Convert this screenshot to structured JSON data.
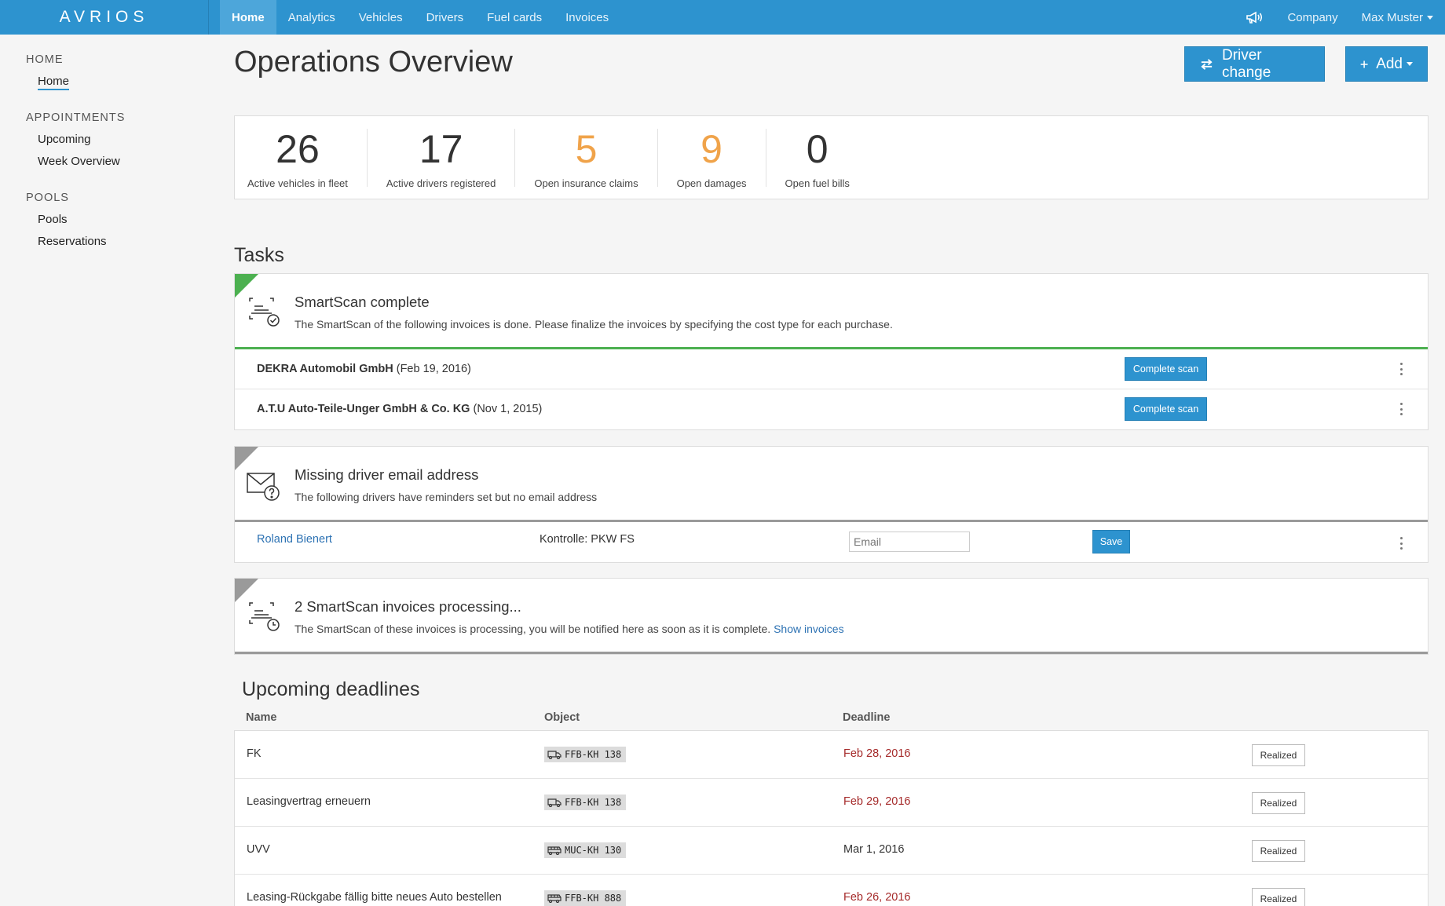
{
  "brand": "AVRIOS",
  "nav": {
    "items": [
      {
        "label": "Home",
        "active": true
      },
      {
        "label": "Analytics"
      },
      {
        "label": "Vehicles"
      },
      {
        "label": "Drivers"
      },
      {
        "label": "Fuel cards"
      },
      {
        "label": "Invoices"
      }
    ],
    "company": "Company",
    "user": "Max Muster",
    "announce_icon": "megaphone-icon"
  },
  "sidebar": {
    "groups": [
      {
        "heading": "HOME",
        "items": [
          "Home"
        ]
      },
      {
        "heading": "APPOINTMENTS",
        "items": [
          "Upcoming",
          "Week Overview"
        ]
      },
      {
        "heading": "POOLS",
        "items": [
          "Pools",
          "Reservations"
        ]
      }
    ]
  },
  "page": {
    "title": "Operations Overview",
    "driver_change_label": "Driver change",
    "add_label": "Add"
  },
  "stats": [
    {
      "value": "26",
      "label": "Active vehicles in fleet",
      "color": "#333333"
    },
    {
      "value": "17",
      "label": "Active drivers registered",
      "color": "#333333"
    },
    {
      "value": "5",
      "label": "Open insurance claims",
      "color": "#f0a34a"
    },
    {
      "value": "9",
      "label": "Open damages",
      "color": "#f0a34a"
    },
    {
      "value": "0",
      "label": "Open fuel bills",
      "color": "#333333"
    }
  ],
  "tasks": {
    "title": "Tasks",
    "smartscan": {
      "title": "SmartScan complete",
      "desc": "The SmartScan of the following invoices is done. Please finalize the invoices by specifying the cost type for each purchase.",
      "rows": [
        {
          "name": "DEKRA Automobil GmbH",
          "date": " (Feb 19, 2016)",
          "button": "Complete scan"
        },
        {
          "name": "A.T.U Auto-Teile-Unger GmbH & Co. KG",
          "date": " (Nov 1, 2015)",
          "button": "Complete scan"
        }
      ]
    },
    "missing_email": {
      "title": "Missing driver email address",
      "desc": "The following drivers have reminders set but no email address",
      "row": {
        "driver": "Roland Bienert",
        "reminder": "Kontrolle: PKW FS",
        "email_placeholder": "Email",
        "button": "Save"
      }
    },
    "processing": {
      "title": "2 SmartScan invoices processing...",
      "desc": "The SmartScan of these invoices is processing, you will be notified here as soon as it is complete. ",
      "link": "Show invoices"
    }
  },
  "deadlines": {
    "title": "Upcoming deadlines",
    "columns": [
      "Name",
      "Object",
      "Deadline"
    ],
    "rows": [
      {
        "name": "FK",
        "plate": "FFB-KH 138",
        "deadline": "Feb 28, 2016",
        "overdue": true,
        "button": "Realized",
        "icon": "truck-icon"
      },
      {
        "name": "Leasingvertrag erneuern",
        "plate": "FFB-KH 138",
        "deadline": "Feb 29, 2016",
        "overdue": true,
        "button": "Realized",
        "icon": "truck-icon"
      },
      {
        "name": "UVV",
        "plate": "MUC-KH 130",
        "deadline": "Mar 1, 2016",
        "overdue": false,
        "button": "Realized",
        "icon": "bus-icon"
      },
      {
        "name": "Leasing-Rückgabe fällig bitte neues Auto bestellen",
        "plate": "FFB-KH 888",
        "deadline": "Feb 26, 2016",
        "overdue": true,
        "button": "Realized",
        "icon": "bus-icon"
      }
    ]
  },
  "colors": {
    "primary": "#2d93cf",
    "green": "#4cb050",
    "orange": "#f0a34a",
    "overdue": "#a52a2a"
  }
}
